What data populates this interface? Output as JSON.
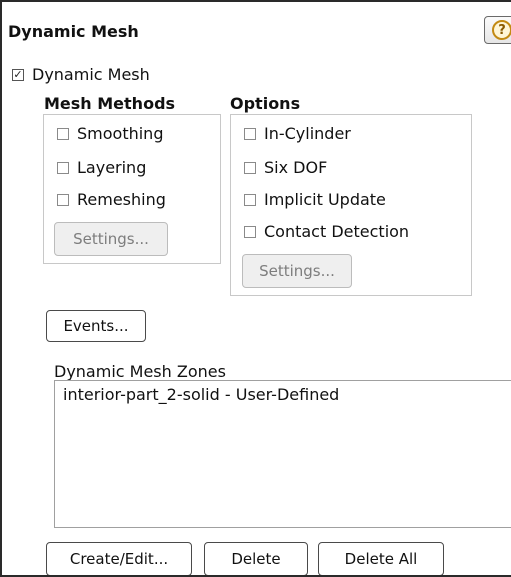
{
  "panel": {
    "title": "Dynamic Mesh",
    "help_icon": "question-mark-icon",
    "help_glyph": "?"
  },
  "dynamic_mesh_toggle": {
    "label": "Dynamic Mesh",
    "checked": true
  },
  "mesh_methods": {
    "title": "Mesh Methods",
    "items": [
      {
        "label": "Smoothing",
        "checked": false
      },
      {
        "label": "Layering",
        "checked": false
      },
      {
        "label": "Remeshing",
        "checked": false
      }
    ],
    "settings_label": "Settings..."
  },
  "options": {
    "title": "Options",
    "items": [
      {
        "label": "In-Cylinder",
        "checked": false
      },
      {
        "label": "Six DOF",
        "checked": false
      },
      {
        "label": "Implicit Update",
        "checked": false
      },
      {
        "label": "Contact Detection",
        "checked": false
      }
    ],
    "settings_label": "Settings..."
  },
  "events_label": "Events...",
  "zones": {
    "title": "Dynamic Mesh Zones",
    "items": [
      "interior-part_2-solid - User-Defined"
    ]
  },
  "buttons": {
    "create_edit": "Create/Edit...",
    "delete": "Delete",
    "delete_all": "Delete All"
  },
  "colors": {
    "panel_border": "#2a2a2a",
    "help_icon_ring": "#c38a12",
    "disabled_button_bg": "#efefef"
  }
}
